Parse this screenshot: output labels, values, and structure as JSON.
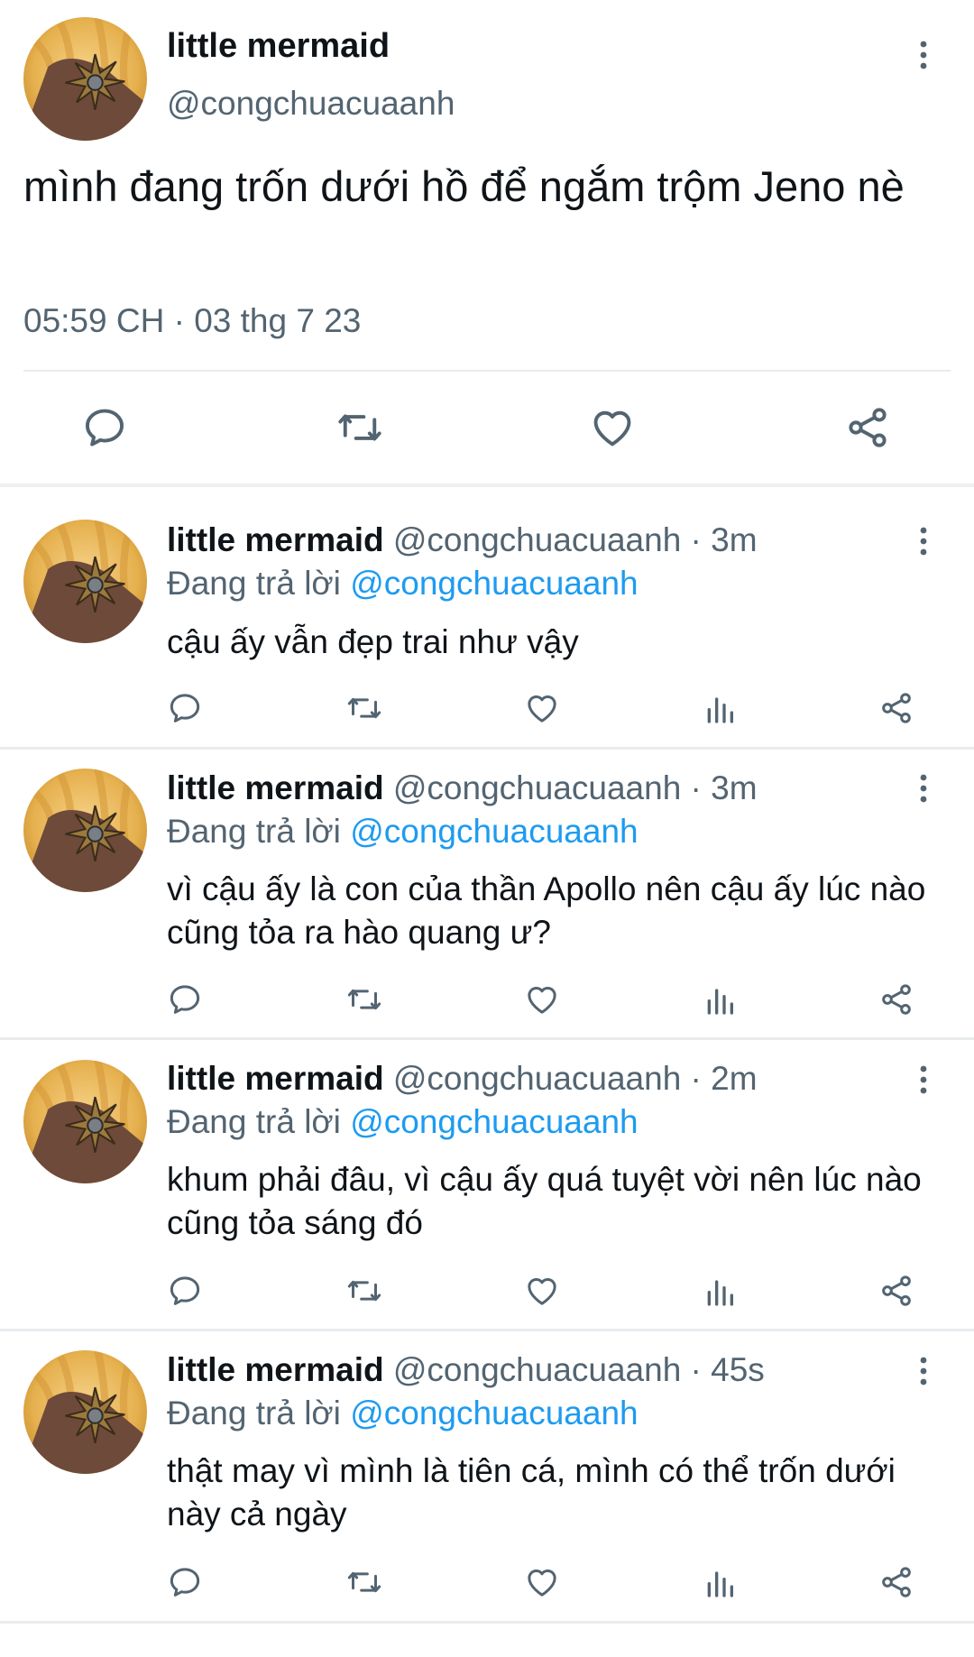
{
  "main_tweet": {
    "display_name": "little mermaid",
    "handle": "@congchuacuaanh",
    "text": "mình đang trốn dưới hồ để ngắm trộm Jeno nè",
    "timestamp": "05:59 CH · 03 thg 7 23",
    "actions": [
      "reply-icon",
      "retweet-icon",
      "like-icon",
      "share-icon"
    ]
  },
  "replies": [
    {
      "display_name": "little mermaid",
      "meta": "@congchuacuaanh · 3m",
      "replying_prefix": "Đang trả lời",
      "replying_to": "@congchuacuaanh",
      "text": "cậu ấy vẫn đẹp trai như vậy"
    },
    {
      "display_name": "little mermaid",
      "meta": "@congchuacuaanh · 3m",
      "replying_prefix": "Đang trả lời",
      "replying_to": "@congchuacuaanh",
      "text": "vì cậu ấy là con của thần Apollo nên cậu ấy lúc nào cũng tỏa ra hào quang ư?"
    },
    {
      "display_name": "little mermaid",
      "meta": "@congchuacuaanh · 2m",
      "replying_prefix": "Đang trả lời",
      "replying_to": "@congchuacuaanh",
      "text": "khum phải đâu, vì cậu ấy quá tuyệt vời nên lúc nào cũng tỏa sáng đó"
    },
    {
      "display_name": "little mermaid",
      "meta": "@congchuacuaanh · 45s",
      "replying_prefix": "Đang trả lời",
      "replying_to": "@congchuacuaanh",
      "text": "thật may vì mình là tiên cá, mình có thể trốn dưới này cả ngày"
    }
  ],
  "colors": {
    "accent": "#1d9bf0",
    "muted": "#536471",
    "text": "#0f1419",
    "avatar_bg": "#e8b45a"
  }
}
